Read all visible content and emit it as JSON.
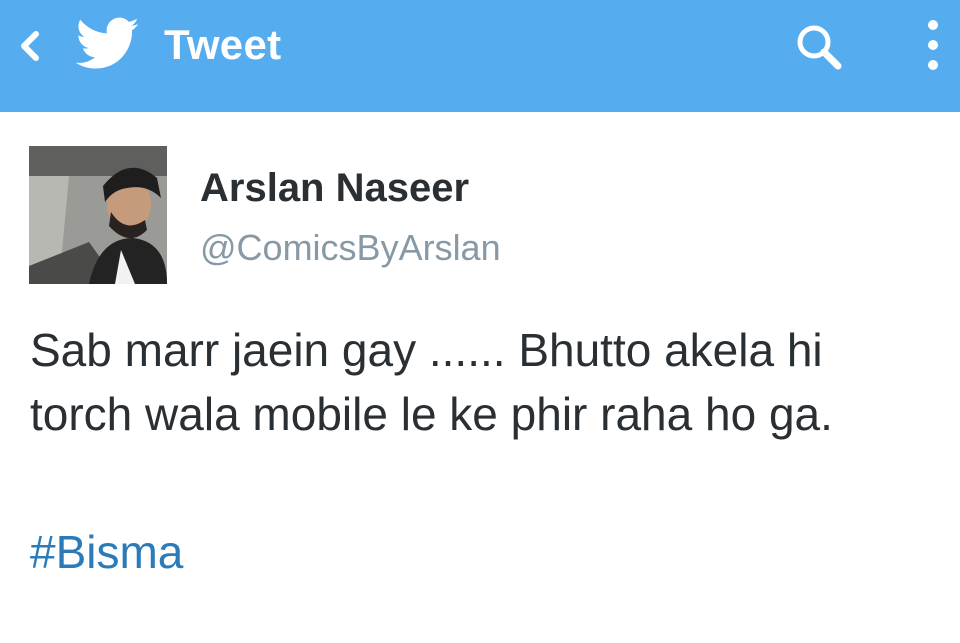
{
  "appbar": {
    "title": "Tweet",
    "background_color": "#55acee",
    "icons": {
      "back": "chevron-left-icon",
      "logo": "twitter-bird-icon",
      "search": "search-icon",
      "overflow": "more-vertical-icon"
    }
  },
  "tweet": {
    "author_name": "Arslan Naseer",
    "author_handle": "@ComicsByArslan",
    "text_line1": "Sab marr jaein gay ...... Bhutto akela hi",
    "text_line2": "torch wala mobile le ke phir raha ho ga.",
    "hashtag": "#Bisma",
    "hashtag_color": "#2b7bb9"
  }
}
